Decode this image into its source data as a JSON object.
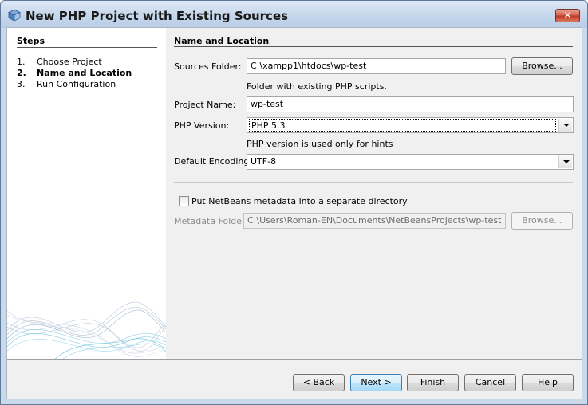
{
  "window": {
    "title": "New PHP Project with Existing Sources",
    "close_label": "✕",
    "icon": "cube-icon"
  },
  "steps": {
    "title": "Steps",
    "items": [
      {
        "num": "1.",
        "label": "Choose Project"
      },
      {
        "num": "2.",
        "label": "Name and Location"
      },
      {
        "num": "3.",
        "label": "Run Configuration"
      }
    ]
  },
  "form": {
    "section_title": "Name and Location",
    "sources_folder": {
      "label": "Sources Folder:",
      "value": "C:\\xampp1\\htdocs\\wp-test",
      "browse": "Browse...",
      "hint": "Folder with existing PHP scripts."
    },
    "project_name": {
      "label": "Project Name:",
      "value": "wp-test"
    },
    "php_version": {
      "label": "PHP Version:",
      "value": "PHP 5.3",
      "hint": "PHP version is used only for hints"
    },
    "default_encoding": {
      "label": "Default Encoding:",
      "value": "UTF-8"
    },
    "metadata_checkbox": {
      "label": "Put NetBeans metadata into a separate directory",
      "checked": false
    },
    "metadata_folder": {
      "label": "Metadata Folder:",
      "value": "C:\\Users\\Roman-EN\\Documents\\NetBeansProjects\\wp-test",
      "browse": "Browse..."
    }
  },
  "buttons": {
    "back": "< Back",
    "next": "Next >",
    "finish": "Finish",
    "cancel": "Cancel",
    "help": "Help"
  }
}
